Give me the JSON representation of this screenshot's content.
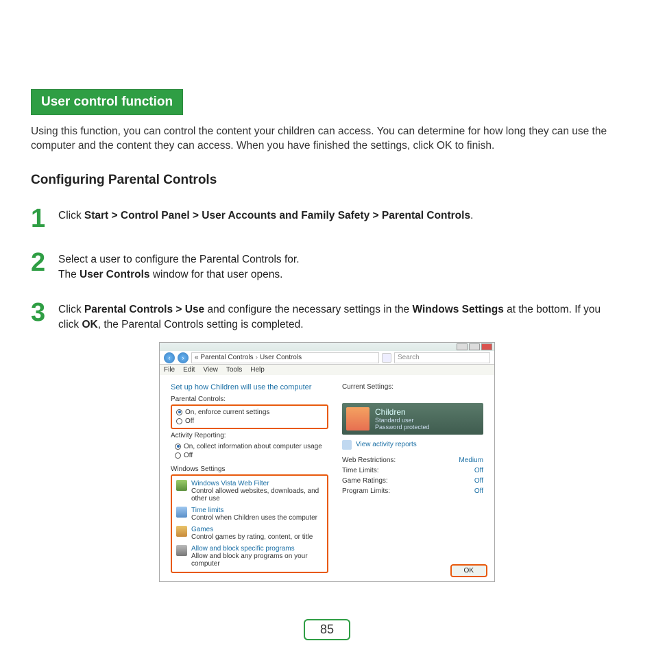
{
  "section_header": "User control function",
  "intro": "Using this function, you can control the content your children can access. You can determine for how long they can use the computer and the content they can access. When you have finished the settings, click OK to finish.",
  "subheading": "Configuring Parental Controls",
  "steps": {
    "1": {
      "num": "1",
      "pre": "Click ",
      "bold": "Start > Control Panel > User Accounts and Family Safety > Parental Controls",
      "post": "."
    },
    "2": {
      "num": "2",
      "line1_a": "Select a user to configure the Parental Controls for.",
      "line2_a": "The ",
      "line2_b": "User Controls",
      "line2_c": " window for that user opens."
    },
    "3": {
      "num": "3",
      "a": "Click ",
      "b": "Parental Controls > Use",
      "c": " and configure the necessary settings in the ",
      "d": "Windows Settings",
      "e": " at the bottom. If you click ",
      "f": "OK",
      "g": ", the Parental Controls setting is completed."
    }
  },
  "screenshot": {
    "breadcrumb": {
      "a": "«  Parental Controls",
      "b": "User Controls",
      "sep": "›"
    },
    "search_placeholder": "Search",
    "menus": [
      "File",
      "Edit",
      "View",
      "Tools",
      "Help"
    ],
    "panel_title": "Set up how Children will use the computer",
    "left": {
      "group1_label": "Parental Controls:",
      "radio_on": "On, enforce current settings",
      "radio_off": "Off",
      "group2_label": "Activity Reporting:",
      "radio2_on": "On, collect information about computer usage",
      "radio2_off": "Off",
      "group3_label": "Windows Settings",
      "items": [
        {
          "title": "Windows Vista Web Filter",
          "desc": "Control allowed websites, downloads, and other use"
        },
        {
          "title": "Time limits",
          "desc": "Control when Children uses the computer"
        },
        {
          "title": "Games",
          "desc": "Control games by rating, content, or title"
        },
        {
          "title": "Allow and block specific programs",
          "desc": "Allow and block any programs on your computer"
        }
      ]
    },
    "right": {
      "current_settings_label": "Current Settings:",
      "user_name": "Children",
      "user_role": "Standard user",
      "user_pwd": "Password protected",
      "view_link": "View activity reports",
      "rows": [
        {
          "k": "Web Restrictions:",
          "v": "Medium"
        },
        {
          "k": "Time Limits:",
          "v": "Off"
        },
        {
          "k": "Game Ratings:",
          "v": "Off"
        },
        {
          "k": "Program Limits:",
          "v": "Off"
        }
      ]
    },
    "ok": "OK"
  },
  "page_number": "85"
}
